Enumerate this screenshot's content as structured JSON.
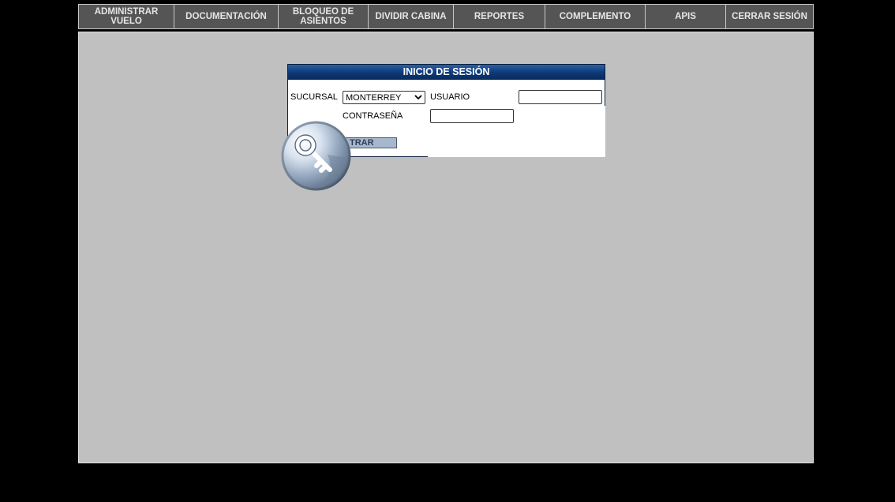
{
  "nav": {
    "items": [
      {
        "label": "ADMINISTRAR VUELO"
      },
      {
        "label": "DOCUMENTACIÓN"
      },
      {
        "label": "BLOQUEO DE ASIENTOS"
      },
      {
        "label": "DIVIDIR CABINA"
      },
      {
        "label": "REPORTES"
      },
      {
        "label": "COMPLEMENTO"
      },
      {
        "label": "APIS"
      },
      {
        "label": "CERRAR SESIÓN"
      }
    ]
  },
  "login": {
    "title": "INICIO DE SESIÓN",
    "sucursal_label": "SUCURSAL",
    "sucursal_value": "MONTERREY",
    "usuario_label": "USUARIO",
    "usuario_value": "",
    "contrasena_label": "CONTRASEÑA",
    "contrasena_value": "",
    "entrar_label": "ENTRAR",
    "entrar_visible": "TRAR"
  },
  "icons": {
    "key": "key-icon",
    "select_arrow": "chevron-down-icon"
  },
  "colors": {
    "header_blue": "#0e3a78",
    "content_gray": "#c0c0c0",
    "nav_gray": "#555555"
  }
}
